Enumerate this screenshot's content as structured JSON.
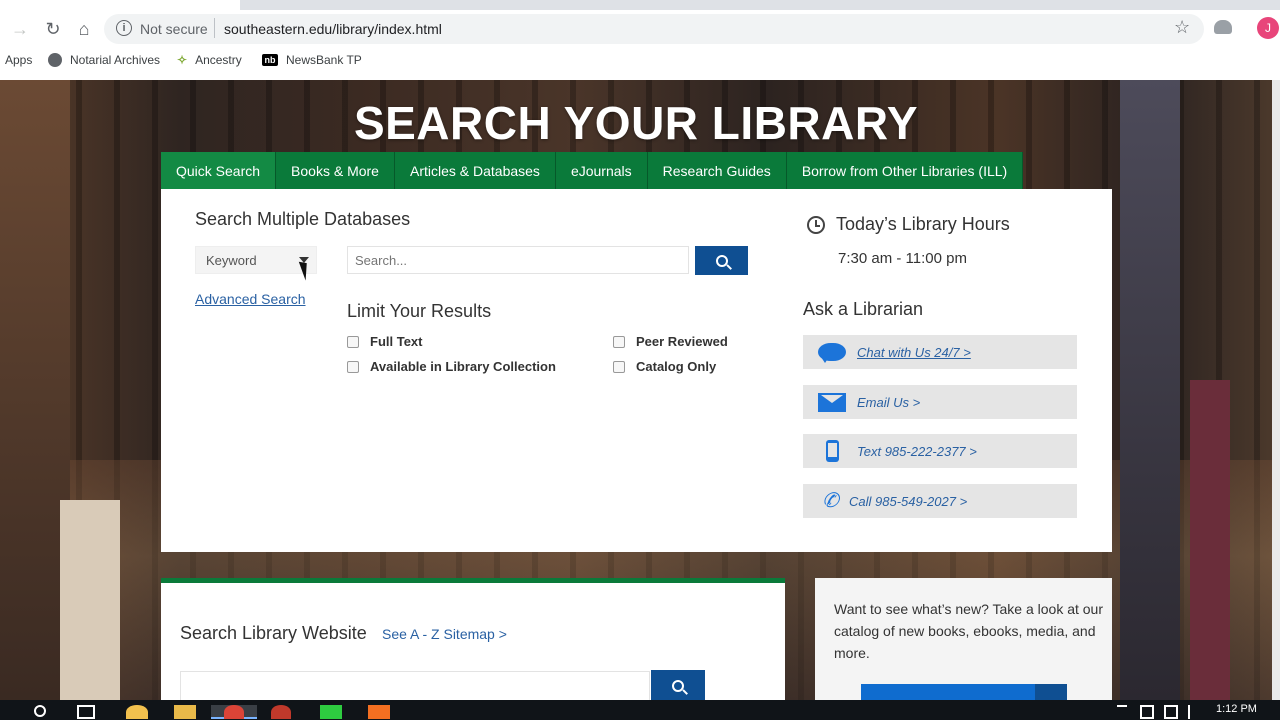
{
  "browser": {
    "security_label": "Not secure",
    "url": "southeastern.edu/library/index.html",
    "profile_initial": "J",
    "bookmarks": [
      {
        "label": "Apps"
      },
      {
        "label": "Notarial Archives"
      },
      {
        "label": "Ancestry"
      },
      {
        "label": "NewsBank TP"
      }
    ]
  },
  "hero": {
    "title": "SEARCH YOUR LIBRARY"
  },
  "tabs": [
    {
      "label": "Quick Search"
    },
    {
      "label": "Books & More"
    },
    {
      "label": "Articles & Databases"
    },
    {
      "label": "eJournals"
    },
    {
      "label": "Research Guides"
    },
    {
      "label": "Borrow from Other Libraries (ILL)"
    }
  ],
  "quick_search": {
    "title": "Search Multiple Databases",
    "field_select": "Keyword",
    "advanced_link": "Advanced Search",
    "search_placeholder": "Search...",
    "limit_title": "Limit Your Results",
    "limits": [
      {
        "label": "Full Text"
      },
      {
        "label": "Peer Reviewed"
      },
      {
        "label": "Available in Library Collection"
      },
      {
        "label": "Catalog Only"
      }
    ]
  },
  "hours": {
    "title": "Today’s Library Hours",
    "value": "7:30 am - 11:00 pm"
  },
  "ask": {
    "title": "Ask a Librarian",
    "contacts": [
      {
        "label": "Chat with Us 24/7 >",
        "icon": "chat-icon"
      },
      {
        "label": "Email Us >",
        "icon": "email-icon"
      },
      {
        "label": "Text 985-222-2377 >",
        "icon": "mobile-phone-icon"
      },
      {
        "label": "Call 985-549-2027 >",
        "icon": "phone-icon"
      }
    ]
  },
  "site_search": {
    "title": "Search Library Website",
    "sitemap_link": "See A - Z Sitemap >"
  },
  "new_items": {
    "text": "Want to see what’s new? Take a look at our catalog of new books, ebooks, media, and more."
  },
  "taskbar": {
    "time": "1:12 PM"
  },
  "colors": {
    "tab_green": "#0a7a3a",
    "button_blue": "#0f4f92",
    "link_blue": "#2a61a3",
    "icon_blue": "#1c74d9"
  }
}
